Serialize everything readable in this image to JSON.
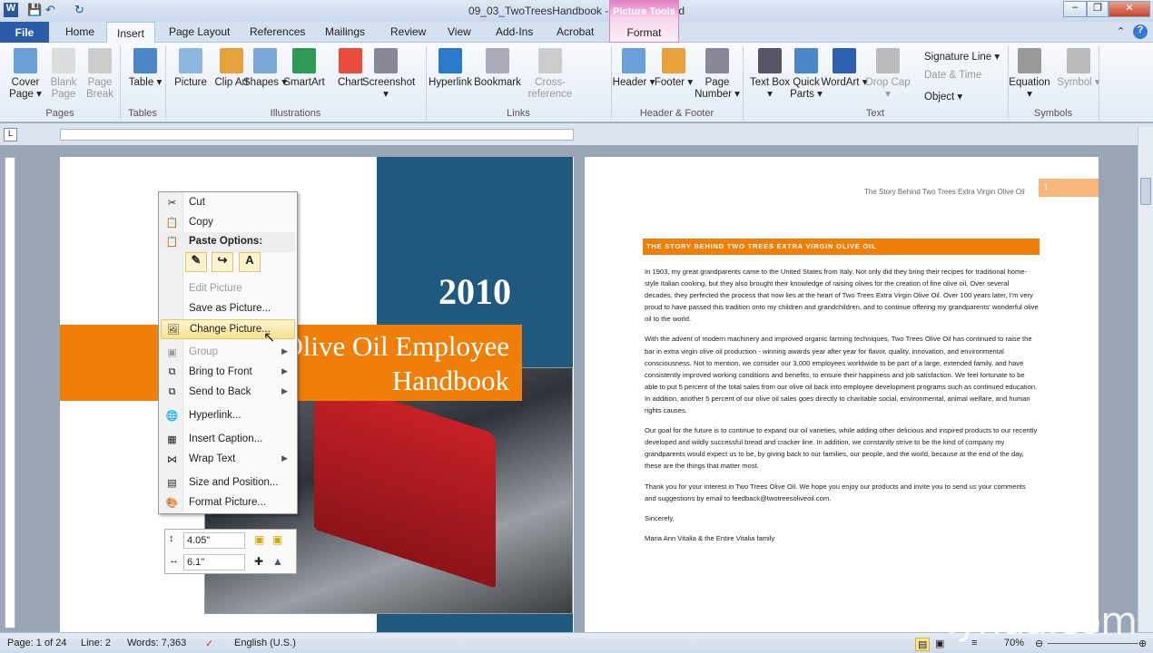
{
  "window": {
    "title": "09_03_TwoTreesHandbook - Microsoft Word",
    "context_tab_group": "Picture Tools",
    "context_tab": "Format"
  },
  "tabs": [
    "File",
    "Home",
    "Insert",
    "Page Layout",
    "References",
    "Mailings",
    "Review",
    "View",
    "Add-Ins",
    "Acrobat"
  ],
  "ribbon": {
    "buttons": [
      {
        "label": "Cover Page ▾"
      },
      {
        "label": "Blank Page"
      },
      {
        "label": "Page Break"
      },
      {
        "label": "Table ▾"
      },
      {
        "label": "Picture"
      },
      {
        "label": "Clip Art"
      },
      {
        "label": "Shapes ▾"
      },
      {
        "label": "SmartArt"
      },
      {
        "label": "Chart"
      },
      {
        "label": "Screenshot ▾"
      },
      {
        "label": "Hyperlink"
      },
      {
        "label": "Bookmark"
      },
      {
        "label": "Cross-reference"
      },
      {
        "label": "Header ▾"
      },
      {
        "label": "Footer ▾"
      },
      {
        "label": "Page Number ▾"
      },
      {
        "label": "Text Box ▾"
      },
      {
        "label": "Quick Parts ▾"
      },
      {
        "label": "WordArt ▾"
      },
      {
        "label": "Drop Cap ▾"
      },
      {
        "label": "Equation ▾"
      },
      {
        "label": "Symbol ▾"
      }
    ],
    "small": [
      "Signature Line ▾",
      "Date & Time",
      "Object ▾"
    ],
    "groups": [
      "Pages",
      "Tables",
      "Illustrations",
      "Links",
      "Header & Footer",
      "Text",
      "Symbols"
    ]
  },
  "cover": {
    "year": "2010",
    "title_line1": "Two Trees Olive Oil Employee",
    "title_line2": "Handbook"
  },
  "page2": {
    "header": "The Story Behind Two Trees Extra Virgin Olive Oil",
    "page_num": "1",
    "heading": "THE STORY BEHIND TWO TREES EXTRA VIRGIN OLIVE OIL",
    "paragraphs": [
      "In 1903, my great grandparents came to the United States from Italy.  Not only did they bring their recipes for traditional home-style Italian cooking, but they also brought their knowledge of raising olives for the creation of fine olive oil. Over several decades, they perfected the process that now lies at the heart of Two Trees Extra Virgin Olive Oil. Over 100 years later, I'm very proud to have passed this tradition onto my children and grandchildren, and to continue offering my grandparents' wonderful olive oil to the world.",
      "With the advent of modern machinery and improved organic farming techniques, Two Trees Olive Oil has continued to raise the bar in extra virgin olive oil production - winning awards year after year for flavor, quality, innovation, and environmental consciousness. Not to mention, we consider our 3,000 employees worldwide to be part of a large, extended family, and have consistently improved working conditions and benefits, to ensure their happiness and job satisfaction. We feel fortunate to be able to put 5 percent of the total sales from our olive oil back into employee development programs such as continued education. In addition, another 5 percent of our olive oil sales goes directly to charitable social, environmental, animal welfare, and human rights causes.",
      "Our goal for the future is to continue to expand our oil varieties, while adding other delicious and inspired products to our recently developed and wildly successful bread and cracker line. In addition, we constantly strive to be the kind of company my grandparents would expect us to be, by giving back to our families, our people, and the world, because at the end of the day, these are the things that matter most.",
      "Thank you for your interest in Two Trees Olive Oil. We hope you enjoy our products and invite you to send us your comments and suggestions by email to feedback@twotreesoliveoil.com.",
      "Sincerely,",
      "Maria Ann Vitalia & the Entire Vitalia family"
    ]
  },
  "context_menu": {
    "items": [
      "Cut",
      "Copy",
      "Paste Options:",
      "Edit Picture",
      "Save as Picture...",
      "Change Picture...",
      "Group",
      "Bring to Front",
      "Send to Back",
      "Hyperlink...",
      "Insert Caption...",
      "Wrap Text",
      "Size and Position...",
      "Format Picture..."
    ]
  },
  "mini_toolbar": {
    "height": "4.05\"",
    "width": "6.1\""
  },
  "status": {
    "page": "Page: 1 of 24",
    "line": "Line: 2",
    "words": "Words: 7,363",
    "language": "English (U.S.)",
    "zoom": "70%"
  },
  "watermark": "lynda.com",
  "colors": {
    "orange": "#f07f0a",
    "blue": "#1f5a7e"
  }
}
